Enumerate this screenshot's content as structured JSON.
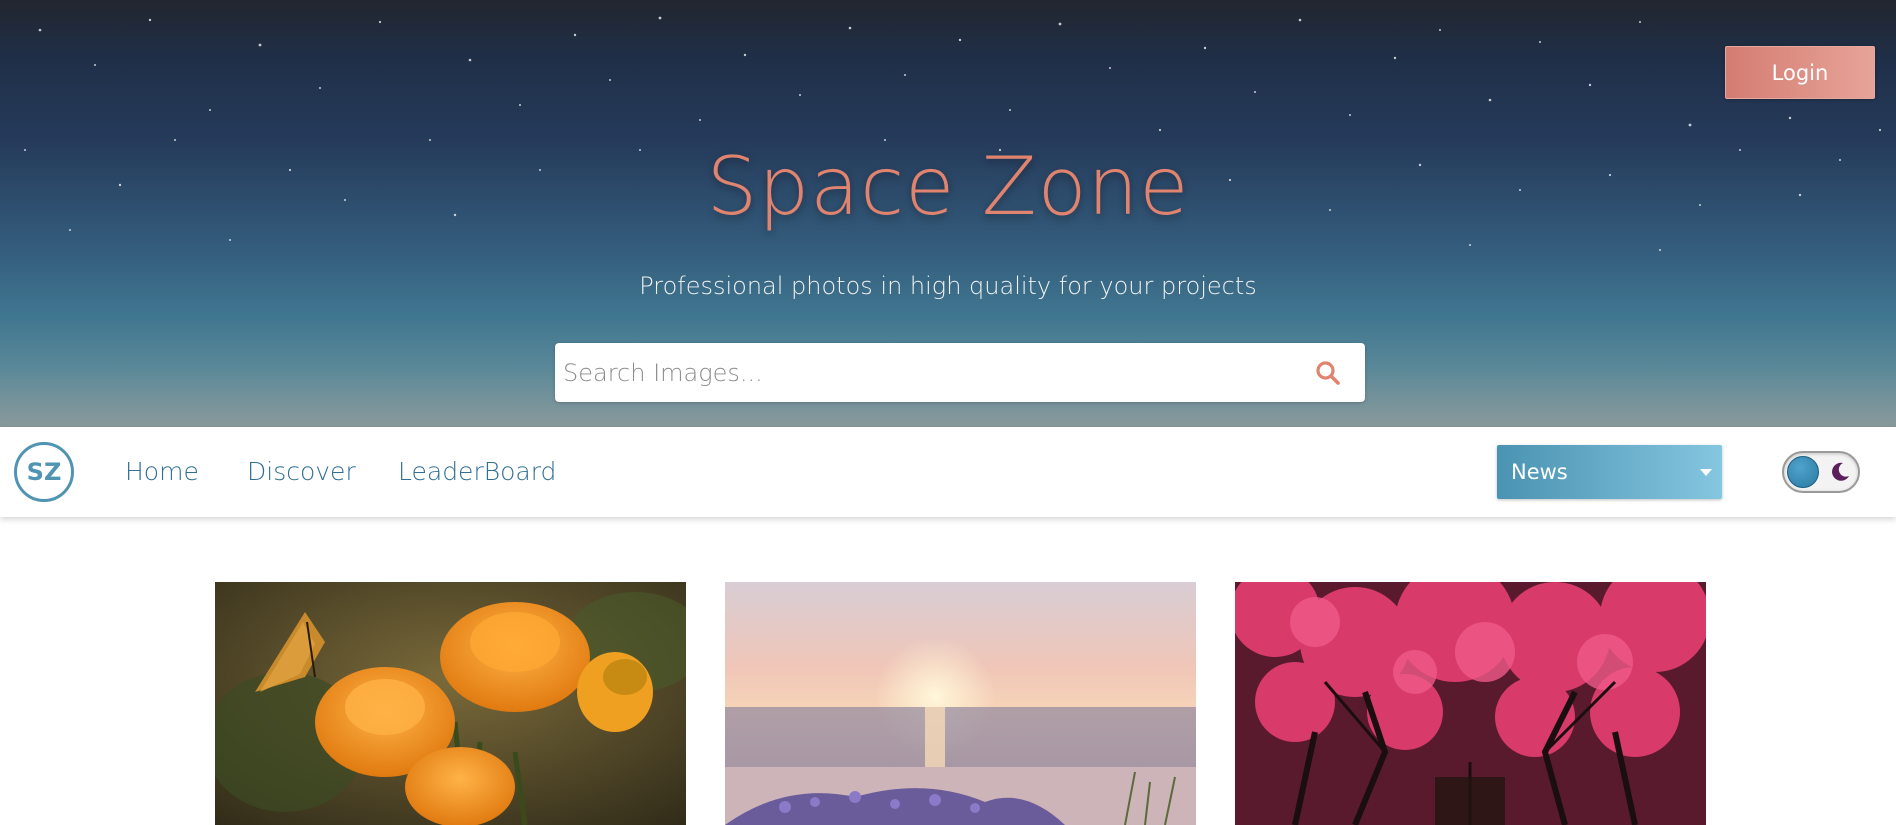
{
  "hero": {
    "login_label": "Login",
    "title": "Space Zone",
    "tagline": "Professional photos in high quality for your projects",
    "search_placeholder": "Search Images...",
    "search_value": ""
  },
  "nav": {
    "logo_text": "SZ",
    "links": [
      "Home",
      "Discover",
      "LeaderBoard"
    ],
    "category_selected": "News",
    "theme_mode": "light"
  },
  "gallery": {
    "images": [
      {
        "subject": "orange flowers with butterfly"
      },
      {
        "subject": "sunset over sea with lavender"
      },
      {
        "subject": "pink blossom tree tunnel"
      }
    ]
  },
  "colors": {
    "accent": "#e0836f",
    "primary": "#4f94b2",
    "nav_text": "#2f6f93"
  },
  "icons": {
    "search": "search-icon",
    "moon": "moon-icon",
    "caret": "chevron-down-icon"
  }
}
